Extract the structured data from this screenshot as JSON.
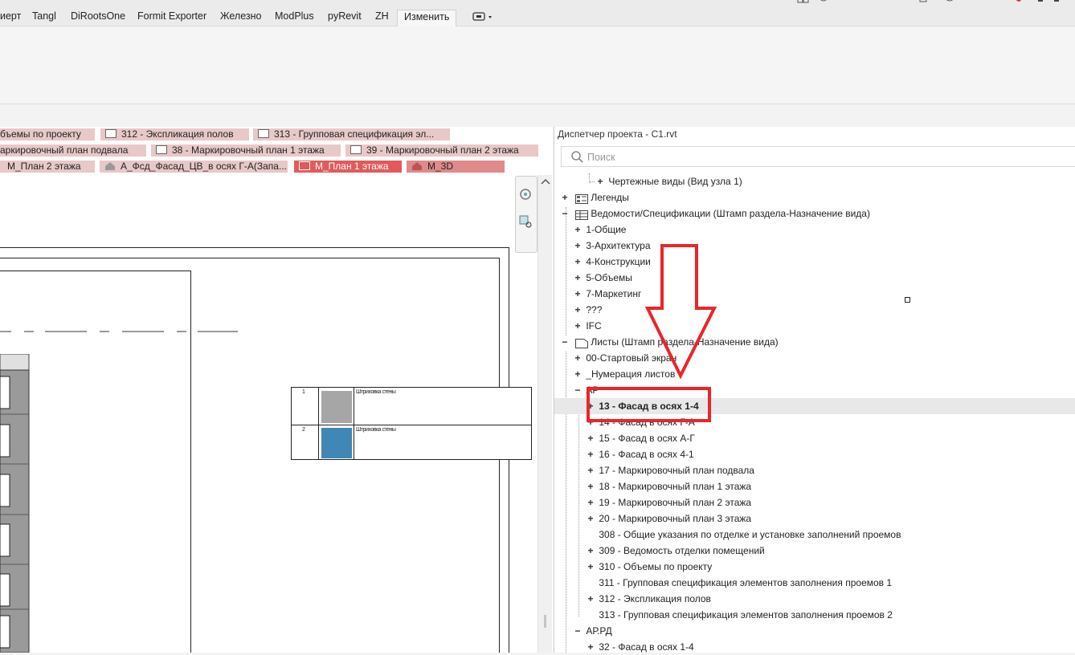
{
  "ribbon": {
    "tabs": [
      "иерт",
      "Tangl",
      "DiRootsOne",
      "Formit Exporter",
      "Железно",
      "ModPlus",
      "pyRevit",
      "ZH",
      "Изменить"
    ],
    "active_tab": "Изменить"
  },
  "view_tabs": {
    "row1": [
      "бъемы по проекту",
      "312 - Экспликация полов",
      "313 - Групповая спецификация эл..."
    ],
    "row2": [
      "аркировочный план подвала",
      "38 - Маркировочный план 1 этажа",
      "39 - Маркировочный план 2 этажа"
    ],
    "row3": [
      "М_План 2 этажа",
      "А_Фсд_Фасад_ЦВ_в осях Г-А(Запа...",
      "М_План 1 этажа",
      "М_3D"
    ]
  },
  "legend_table": {
    "rows": [
      {
        "num": "1",
        "swatch_color": "#a6a6a6",
        "text": "Штриховка стены"
      },
      {
        "num": "2",
        "swatch_color": "#3f87b5",
        "text": "Штриховка стены"
      }
    ]
  },
  "browser": {
    "title": "Диспетчер проекта - C1.rvt",
    "search_placeholder": "Поиск",
    "items": [
      {
        "toggle": "+",
        "label": "Чертежные виды (Вид узла 1)"
      },
      {
        "toggle": "+",
        "label": "Легенды"
      },
      {
        "toggle": "−",
        "label": "Ведомости/Спецификации (Штамп раздела-Назначение вида)"
      },
      {
        "toggle": "+",
        "label": "1-Общие"
      },
      {
        "toggle": "+",
        "label": "3-Архитектура"
      },
      {
        "toggle": "+",
        "label": "4-Конструкции"
      },
      {
        "toggle": "+",
        "label": "5-Объемы"
      },
      {
        "toggle": "+",
        "label": "7-Маркетинг"
      },
      {
        "toggle": "+",
        "label": "???"
      },
      {
        "toggle": "+",
        "label": "IFC"
      },
      {
        "toggle": "−",
        "label": "Листы (Штамп раздела-Назначение вида)"
      },
      {
        "toggle": "+",
        "label": "00-Стартовый экран"
      },
      {
        "toggle": "+",
        "label": "_Нумерация листов"
      },
      {
        "toggle": "−",
        "label": "АР"
      },
      {
        "toggle": "+",
        "label": "13 - Фасад в осях 1-4"
      },
      {
        "toggle": "+",
        "label": "14 - Фасад в осях Г-А"
      },
      {
        "toggle": "+",
        "label": "15 - Фасад в осях А-Г"
      },
      {
        "toggle": "+",
        "label": "16 - Фасад в осях 4-1"
      },
      {
        "toggle": "+",
        "label": "17 - Маркировочный план подвала"
      },
      {
        "toggle": "+",
        "label": "18 - Маркировочный план 1 этажа"
      },
      {
        "toggle": "+",
        "label": "19 - Маркировочный план 2 этажа"
      },
      {
        "toggle": "+",
        "label": "20 - Маркировочный план 3 этажа"
      },
      {
        "toggle": "",
        "label": "308 - Общие указания по отделке и установке заполнений проемов"
      },
      {
        "toggle": "+",
        "label": "309 - Ведомость отделки помещений"
      },
      {
        "toggle": "+",
        "label": "310 - Объемы по проекту"
      },
      {
        "toggle": "",
        "label": "311 - Групповая спецификация элементов заполнения проемов 1"
      },
      {
        "toggle": "+",
        "label": "312 - Экспликация полов"
      },
      {
        "toggle": "",
        "label": "313 - Групповая спецификация элементов заполнения проемов 2"
      },
      {
        "toggle": "−",
        "label": "АР.РД"
      },
      {
        "toggle": "+",
        "label": "32 - Фасад в осях 1-4"
      }
    ]
  },
  "annotation": {
    "color": "#e8262b"
  }
}
